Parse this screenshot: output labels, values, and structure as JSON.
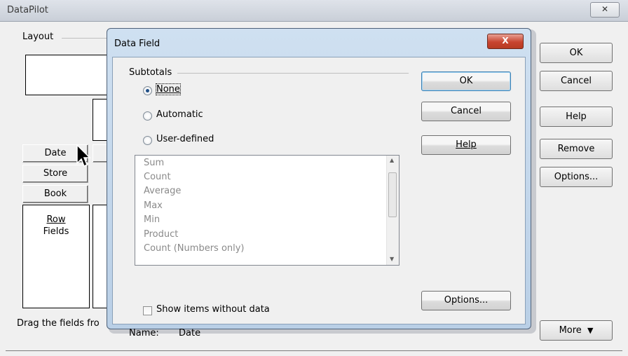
{
  "datapilot": {
    "title": "DataPilot",
    "close_glyph": "✕",
    "layout_label": "Layout",
    "fields": [
      "Date",
      "Store",
      "Book"
    ],
    "row_fields_line1": "Row",
    "row_fields_line2": "Fields",
    "hint_text": "Drag the fields fro",
    "buttons": {
      "ok": "OK",
      "cancel": "Cancel",
      "help": "Help",
      "remove": "Remove",
      "options": "Options...",
      "more": "More"
    }
  },
  "data_field_dialog": {
    "title": "Data Field",
    "close_glyph": "X",
    "subtotals_label": "Subtotals",
    "radio_none": "None",
    "radio_automatic": "Automatic",
    "radio_user_defined": "User-defined",
    "selected_option": "None",
    "functions": [
      "Sum",
      "Count",
      "Average",
      "Max",
      "Min",
      "Product",
      "Count (Numbers only)"
    ],
    "show_items_label": "Show items without data",
    "show_items_checked": false,
    "name_label": "Name:",
    "name_value": "Date",
    "buttons": {
      "ok": "OK",
      "cancel": "Cancel",
      "help": "Help",
      "options": "Options..."
    }
  }
}
